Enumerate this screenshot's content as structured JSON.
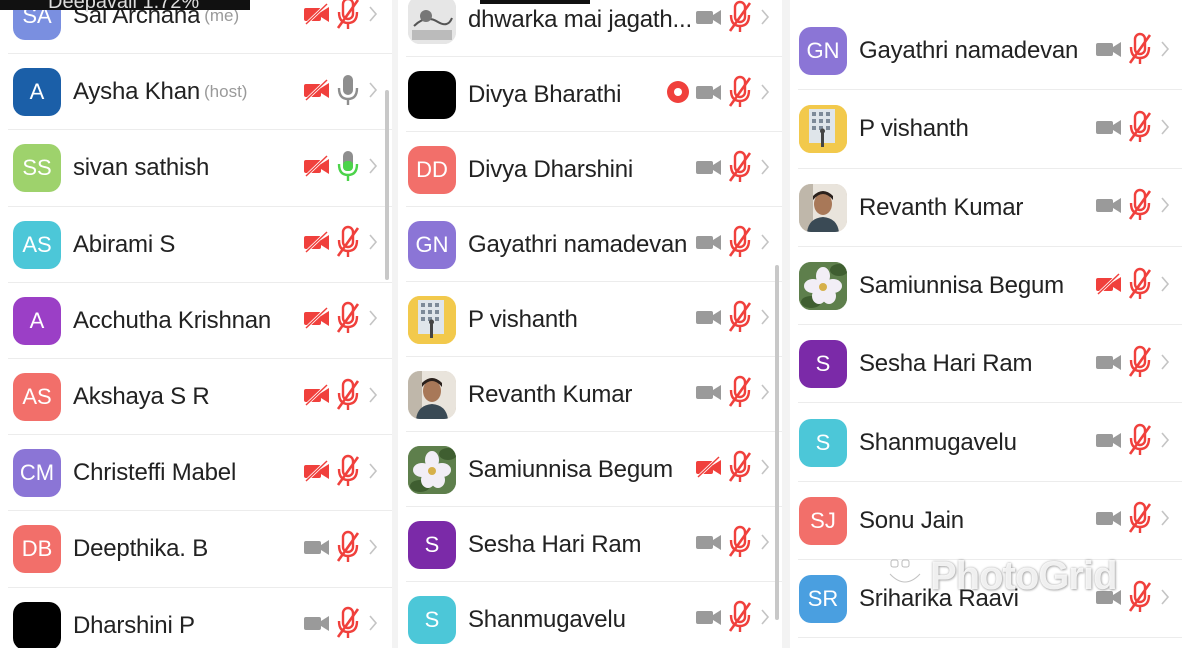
{
  "colors": {
    "cam_off_red": "#f0403c",
    "mic_off_red": "#f0403c",
    "mic_on_gray": "#8e8e8e",
    "mic_live_green": "#4cd34a",
    "cam_gray": "#9a9a9a",
    "chevron": "#c4c4c4",
    "record_red": "#f0403c"
  },
  "status_bar": {
    "partial_text": "Deepavali 1.72% "
  },
  "columns": [
    {
      "id": "col1",
      "rows": [
        {
          "initials": "SA",
          "color": "#7a8fe0",
          "name": "Sai Archana",
          "role": "(me)",
          "cam": "off-red",
          "mic": "off-red",
          "partial": true
        },
        {
          "initials": "A",
          "color": "#1b5fa8",
          "name": "Aysha Khan",
          "role": "(host)",
          "cam": "off-red",
          "mic": "on-gray"
        },
        {
          "initials": "SS",
          "color": "#9ed26c",
          "name": "sivan sathish",
          "role": "",
          "cam": "off-red",
          "mic": "on-green"
        },
        {
          "initials": "AS",
          "color": "#4cc7d8",
          "name": "Abirami S",
          "role": "",
          "cam": "off-red",
          "mic": "off-red"
        },
        {
          "initials": "A",
          "color": "#9b3fc6",
          "name": "Acchutha Krishnan",
          "role": "",
          "cam": "off-red",
          "mic": "off-red"
        },
        {
          "initials": "AS",
          "color": "#f26f6a",
          "name": "Akshaya S R",
          "role": "",
          "cam": "off-red",
          "mic": "off-red"
        },
        {
          "initials": "CM",
          "color": "#8b75d6",
          "name": "Christeffi Mabel",
          "role": "",
          "cam": "off-red",
          "mic": "off-red"
        },
        {
          "initials": "DB",
          "color": "#f26f6a",
          "name": "Deepthika. B",
          "role": "",
          "cam": "gray",
          "mic": "off-red"
        },
        {
          "initials": "",
          "color": "#000000",
          "name": "Dharshini P",
          "role": "",
          "cam": "gray",
          "mic": "off-red"
        }
      ]
    },
    {
      "id": "col2",
      "rows": [
        {
          "initials": "",
          "color": "#d8d8d8",
          "photo": "sketch",
          "name": "dhwarka mai jagath...",
          "role": "",
          "cam": "gray",
          "mic": "off-red",
          "partial": true
        },
        {
          "initials": "",
          "color": "#000000",
          "name": "Divya Bharathi",
          "role": "",
          "cam": "gray",
          "mic": "off-red",
          "record": true
        },
        {
          "initials": "DD",
          "color": "#f26f6a",
          "name": "Divya Dharshini",
          "role": "",
          "cam": "gray",
          "mic": "off-red"
        },
        {
          "initials": "GN",
          "color": "#8b75d6",
          "name": "Gayathri namadevan",
          "role": "",
          "cam": "gray",
          "mic": "off-red"
        },
        {
          "initials": "",
          "color": "#f2c94c",
          "photo": "building",
          "name": "P vishanth",
          "role": "",
          "cam": "gray",
          "mic": "off-red"
        },
        {
          "initials": "",
          "color": "#c9b8a6",
          "photo": "person",
          "name": "Revanth Kumar",
          "role": "",
          "cam": "gray",
          "mic": "off-red"
        },
        {
          "initials": "",
          "color": "#6c8f5a",
          "photo": "flower",
          "name": "Samiunnisa Begum",
          "role": "",
          "cam": "off-red",
          "mic": "off-red"
        },
        {
          "initials": "S",
          "color": "#7b2aa8",
          "name": "Sesha Hari Ram",
          "role": "",
          "cam": "gray",
          "mic": "off-red"
        },
        {
          "initials": "S",
          "color": "#4cc7d8",
          "name": "Shanmugavelu",
          "role": "",
          "cam": "gray",
          "mic": "off-red"
        }
      ]
    },
    {
      "id": "col3",
      "rows": [
        {
          "initials": "GN",
          "color": "#8b75d6",
          "name": "Gayathri namadevan",
          "role": "",
          "cam": "gray",
          "mic": "off-red"
        },
        {
          "initials": "",
          "color": "#f2c94c",
          "photo": "building",
          "name": "P vishanth",
          "role": "",
          "cam": "gray",
          "mic": "off-red"
        },
        {
          "initials": "",
          "color": "#c9b8a6",
          "photo": "person",
          "name": "Revanth Kumar",
          "role": "",
          "cam": "gray",
          "mic": "off-red"
        },
        {
          "initials": "",
          "color": "#6c8f5a",
          "photo": "flower",
          "name": "Samiunnisa Begum",
          "role": "",
          "cam": "off-red",
          "mic": "off-red"
        },
        {
          "initials": "S",
          "color": "#7b2aa8",
          "name": "Sesha Hari Ram",
          "role": "",
          "cam": "gray",
          "mic": "off-red"
        },
        {
          "initials": "S",
          "color": "#4cc7d8",
          "name": "Shanmugavelu",
          "role": "",
          "cam": "gray",
          "mic": "off-red"
        },
        {
          "initials": "SJ",
          "color": "#f26f6a",
          "name": "Sonu Jain",
          "role": "",
          "cam": "gray",
          "mic": "off-red"
        },
        {
          "initials": "SR",
          "color": "#4a9fe0",
          "name": "Sriharika Raavi",
          "role": "",
          "cam": "gray",
          "mic": "off-red"
        }
      ]
    }
  ],
  "watermark": "PhotoGrid"
}
